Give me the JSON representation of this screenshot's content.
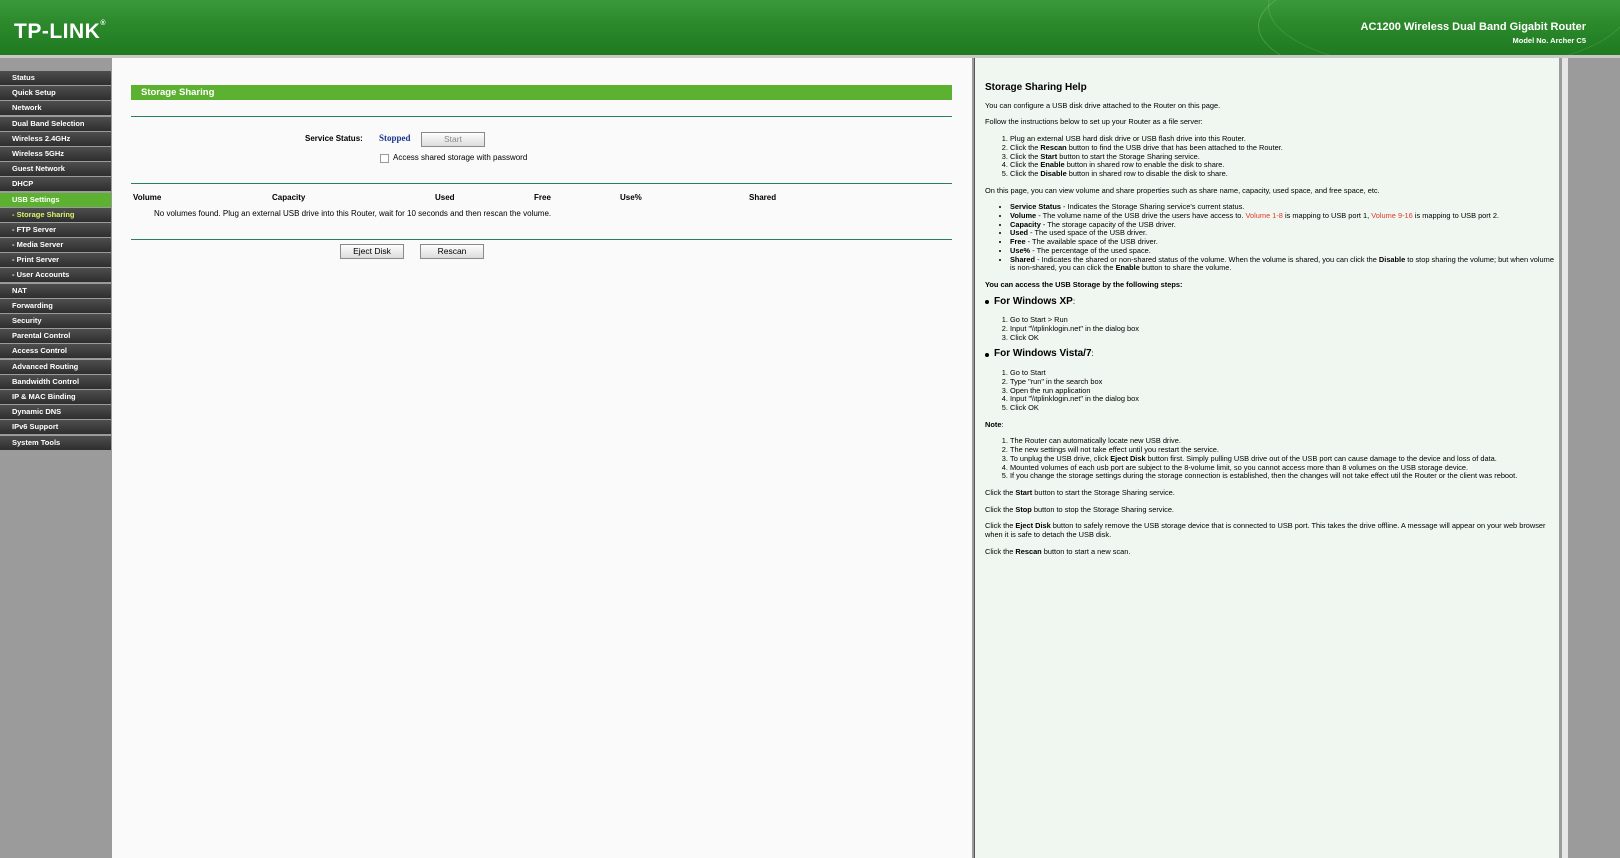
{
  "header": {
    "logo": "TP-LINK",
    "product": "AC1200 Wireless Dual Band Gigabit Router",
    "model": "Model No. Archer C5"
  },
  "sidebar": {
    "items": [
      {
        "label": "Status"
      },
      {
        "label": "Quick Setup"
      },
      {
        "label": "Network"
      },
      {
        "label": "Dual Band Selection"
      },
      {
        "label": "Wireless 2.4GHz"
      },
      {
        "label": "Wireless 5GHz"
      },
      {
        "label": "Guest Network"
      },
      {
        "label": "DHCP"
      },
      {
        "label": "USB Settings"
      },
      {
        "label": "- Storage Sharing"
      },
      {
        "label": "- FTP Server"
      },
      {
        "label": "- Media Server"
      },
      {
        "label": "- Print Server"
      },
      {
        "label": "- User Accounts"
      },
      {
        "label": "NAT"
      },
      {
        "label": "Forwarding"
      },
      {
        "label": "Security"
      },
      {
        "label": "Parental Control"
      },
      {
        "label": "Access Control"
      },
      {
        "label": "Advanced Routing"
      },
      {
        "label": "Bandwidth Control"
      },
      {
        "label": "IP & MAC Binding"
      },
      {
        "label": "Dynamic DNS"
      },
      {
        "label": "IPv6 Support"
      },
      {
        "label": "System Tools"
      }
    ]
  },
  "main": {
    "title": "Storage Sharing",
    "service_status_label": "Service Status:",
    "service_status_value": "Stopped",
    "start_button": "Start",
    "password_checkbox_label": "Access shared storage with password",
    "password_checked": false,
    "table_headers": [
      "Volume",
      "Capacity",
      "Used",
      "Free",
      "Use%",
      "Shared"
    ],
    "empty_message": "No volumes found. Plug an external USB drive into this Router, wait for 10 seconds and then rescan the volume.",
    "eject_button": "Eject Disk",
    "rescan_button": "Rescan"
  },
  "help": {
    "title": "Storage Sharing Help",
    "intro": "You can configure a USB disk drive attached to the Router on this page.",
    "follow": "Follow the instructions below to set up your Router as a file server:",
    "steps": [
      {
        "a": "Plug an external USB hard disk drive or USB flash drive into this Router.",
        "b": "",
        "c": ""
      },
      {
        "a": "Click the ",
        "b": "Rescan",
        "c": " button to find the USB drive that has been attached to the Router."
      },
      {
        "a": "Click the ",
        "b": "Start",
        "c": " button to start the Storage Sharing service."
      },
      {
        "a": "Click the ",
        "b": "Enable",
        "c": " button in shared row to enable the disk to share."
      },
      {
        "a": "Click the ",
        "b": "Disable",
        "c": " button in shared row to disable the disk to share."
      }
    ],
    "onpage": "On this page, you can view volume and share properties such as share name, capacity, used space, and free space, etc.",
    "defs": {
      "service_status_term": "Service Status",
      "service_status_text": " - Indicates the Storage Sharing service's current status.",
      "volume_term": "Volume",
      "volume_text1": " - The volume name of the USB drive the users have access to. ",
      "volume_red1": "Volume 1-8",
      "volume_text2": " is mapping to USB port 1, ",
      "volume_red2": "Volume 9-16",
      "volume_text3": " is mapping to USB port 2.",
      "capacity_term": "Capacity",
      "capacity_text": " - The storage capacity of the USB driver.",
      "used_term": "Used",
      "used_text": " - The used space of the USB driver.",
      "free_term": "Free",
      "free_text": " - The available space of the USB driver.",
      "usep_term": "Use%",
      "usep_text": " - The percentage of the used space.",
      "shared_term": "Shared",
      "shared_text1": " - Indicates the shared or non-shared status of the volume. When the volume is shared, you can click the ",
      "shared_b1": "Disable",
      "shared_text2": " to stop sharing the volume; but when volume is non-shared, you can click the ",
      "shared_b2": "Enable",
      "shared_text3": " button to share the volume."
    },
    "access_heading": "You can access the USB Storage by the following steps:",
    "xp_heading": "For Windows XP",
    "xp_colon": ":",
    "xp_steps": [
      "Go to Start > Run",
      "Input \"\\\\tplinklogin.net\" in the dialog box",
      "Click OK"
    ],
    "vista_heading": "For Windows Vista/7",
    "vista_colon": ":",
    "vista_steps": [
      "Go to Start",
      "Type \"run\" in the search box",
      "Open the run application",
      "Input \"\\\\tplinklogin.net\" in the dialog box",
      "Click OK"
    ],
    "note_heading": "Note",
    "note_colon": ":",
    "notes": [
      {
        "a": "The Router can automatically locate new USB drive.",
        "b": "",
        "c": ""
      },
      {
        "a": "The new settings will not take effect until you restart the service.",
        "b": "",
        "c": ""
      },
      {
        "a": "To unplug the USB drive, click ",
        "b": "Eject Disk",
        "c": " button first. Simply pulling USB drive out of the USB port can cause damage to the device and loss of data."
      },
      {
        "a": "Mounted volumes of each usb port are subject to the 8-volume limit, so you cannot access more than 8 volumes on the USB storage device.",
        "b": "",
        "c": ""
      },
      {
        "a": "If you change the storage settings during the storage connection is established, then the changes will not take effect util the Router or the client was reboot.",
        "b": "",
        "c": ""
      }
    ],
    "click_start": {
      "a": "Click the ",
      "b": "Start",
      "c": " button to start the Storage Sharing service."
    },
    "click_stop": {
      "a": "Click the ",
      "b": "Stop",
      "c": " button to stop the Storage Sharing service."
    },
    "click_eject": {
      "a": "Click the ",
      "b": "Eject Disk",
      "c": " button to safely remove the USB storage device that is connected to USB port. This takes the drive offline. A message will appear on your web browser when it is safe to detach the USB disk."
    },
    "click_rescan": {
      "a": "Click the ",
      "b": "Rescan",
      "c": " button to start a new scan."
    }
  },
  "colors": {
    "header_green": "#2c8a2c",
    "accent_green": "#5cb230",
    "status_blue": "#1d3a8c",
    "help_red": "#e03a2e"
  }
}
